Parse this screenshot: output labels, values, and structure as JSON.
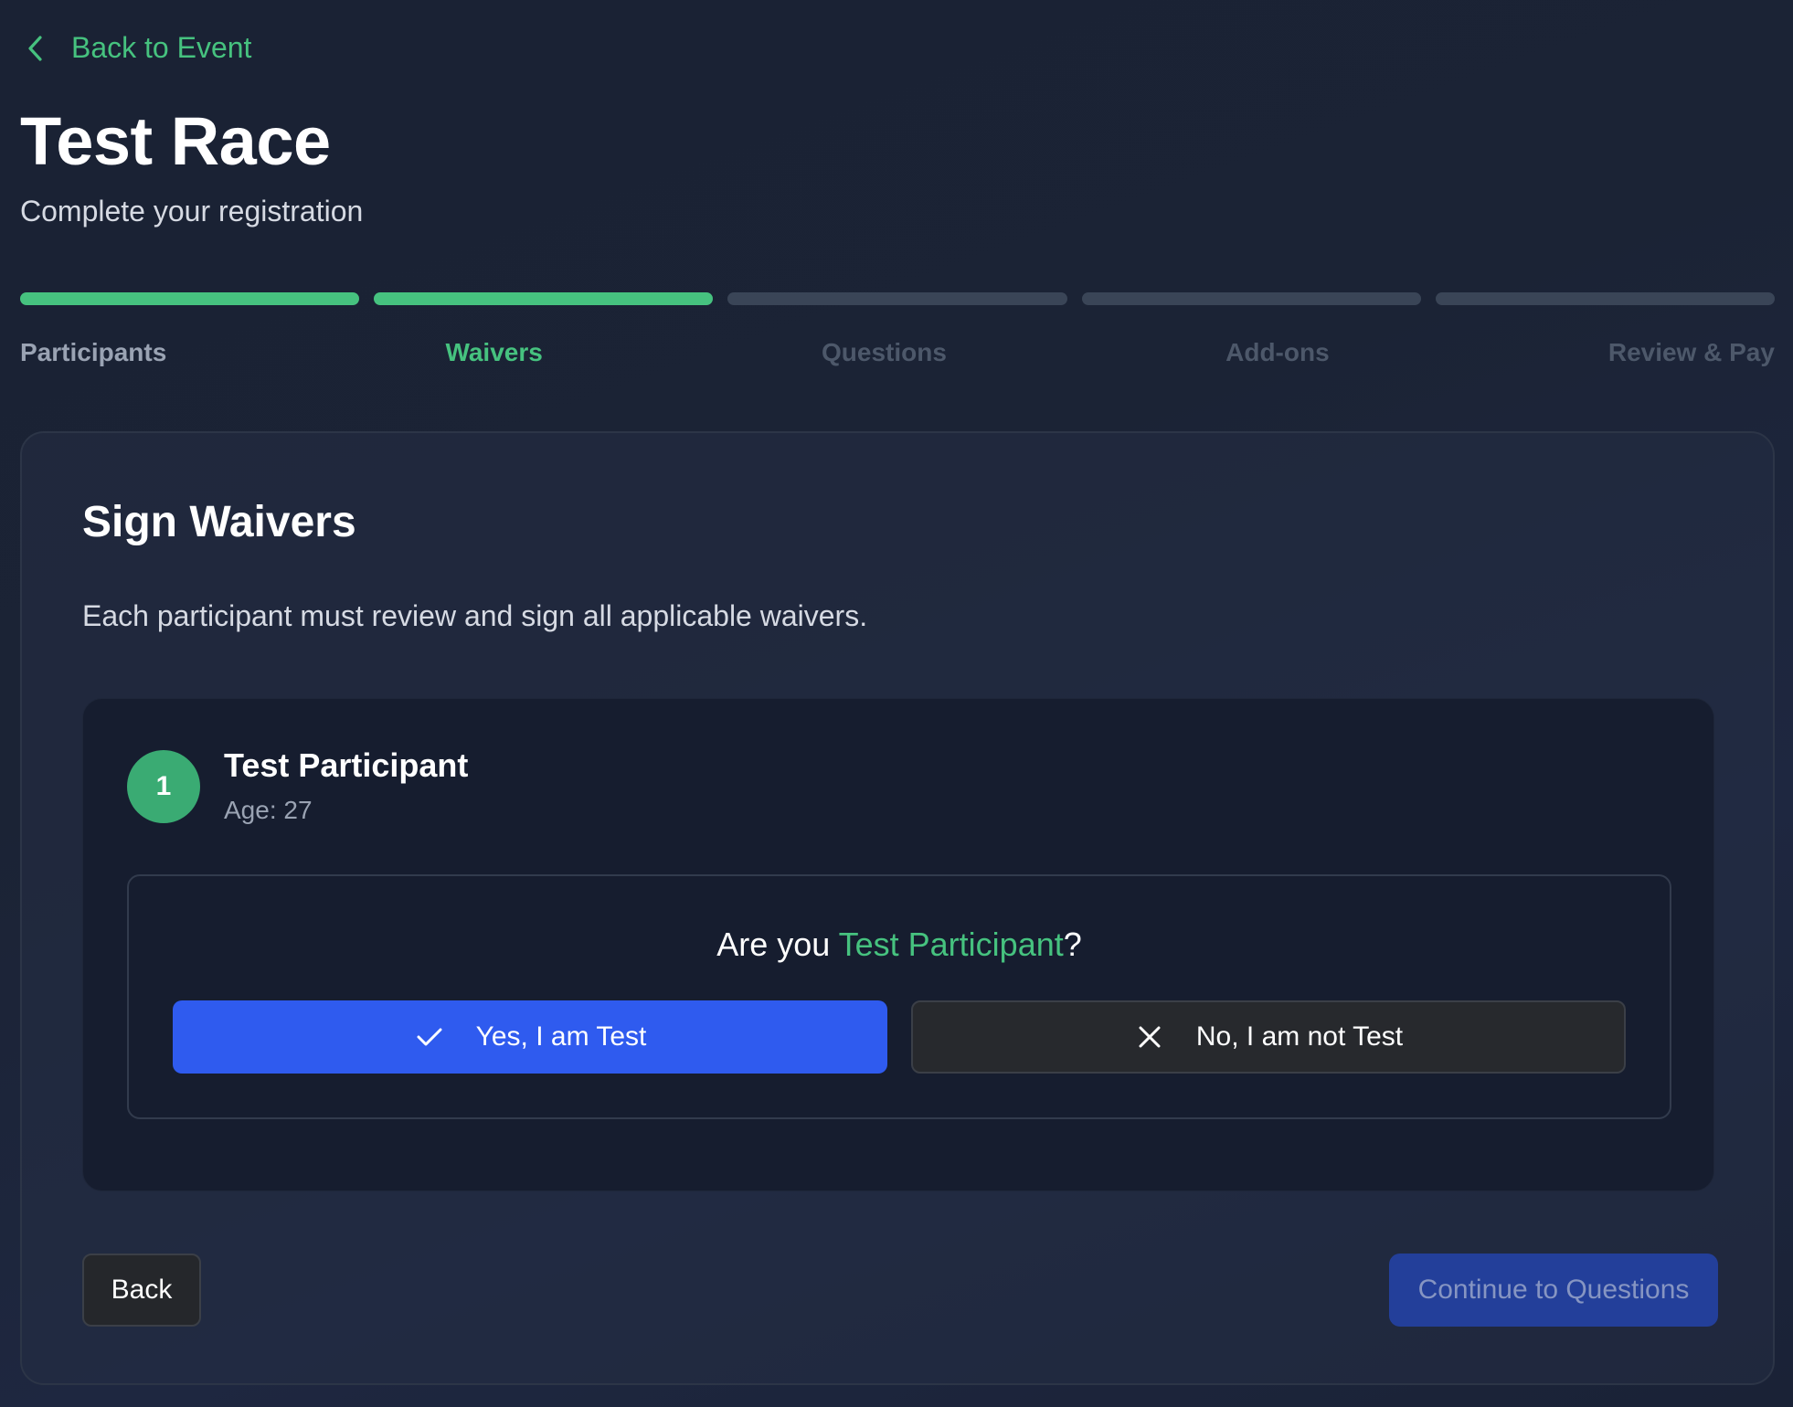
{
  "nav": {
    "back_label": "Back to Event",
    "back_icon": "chevron-left-icon"
  },
  "header": {
    "title": "Test Race",
    "subtitle": "Complete your registration"
  },
  "steps": [
    {
      "label": "Participants",
      "status": "done"
    },
    {
      "label": "Waivers",
      "status": "active"
    },
    {
      "label": "Questions",
      "status": "pending"
    },
    {
      "label": "Add-ons",
      "status": "pending"
    },
    {
      "label": "Review & Pay",
      "status": "pending"
    }
  ],
  "card": {
    "title": "Sign Waivers",
    "description": "Each participant must review and sign all applicable waivers."
  },
  "participant": {
    "number": "1",
    "name": "Test Participant",
    "age_text": "Age: 27",
    "confirm": {
      "question_prefix": "Are you ",
      "question_name": "Test Participant",
      "question_suffix": "?",
      "yes_label": "Yes, I am Test",
      "no_label": "No, I am not Test",
      "yes_icon": "check-icon",
      "no_icon": "close-icon"
    }
  },
  "footer": {
    "back_label": "Back",
    "continue_label": "Continue to Questions"
  },
  "colors": {
    "accent_green": "#46c27f",
    "primary_blue": "#2f5bef",
    "disabled_blue": "#233f9a",
    "background": "#1a2234"
  }
}
